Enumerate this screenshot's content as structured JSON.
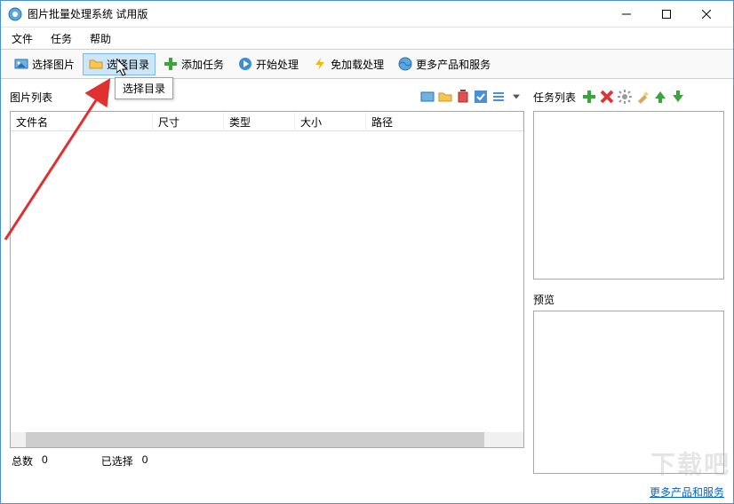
{
  "titlebar": {
    "text": "图片批量处理系统 试用版"
  },
  "menubar": {
    "file": "文件",
    "task": "任务",
    "help": "帮助"
  },
  "toolbar": {
    "select_images": "选择图片",
    "select_folder": "选择目录",
    "add_task": "添加任务",
    "start": "开始处理",
    "fast": "免加载处理",
    "more": "更多产品和服务"
  },
  "tooltip": {
    "text": "选择目录"
  },
  "left": {
    "title": "图片列表",
    "columns": {
      "filename": "文件名",
      "size": "尺寸",
      "type": "类型",
      "filesize": "大小",
      "path": "路径"
    },
    "total_label": "总数",
    "total_value": "0",
    "selected_label": "已选择",
    "selected_value": "0"
  },
  "right": {
    "task_title": "任务列表",
    "preview_title": "预览"
  },
  "footer": {
    "link": "更多产品和服务"
  },
  "watermark": "下载吧"
}
